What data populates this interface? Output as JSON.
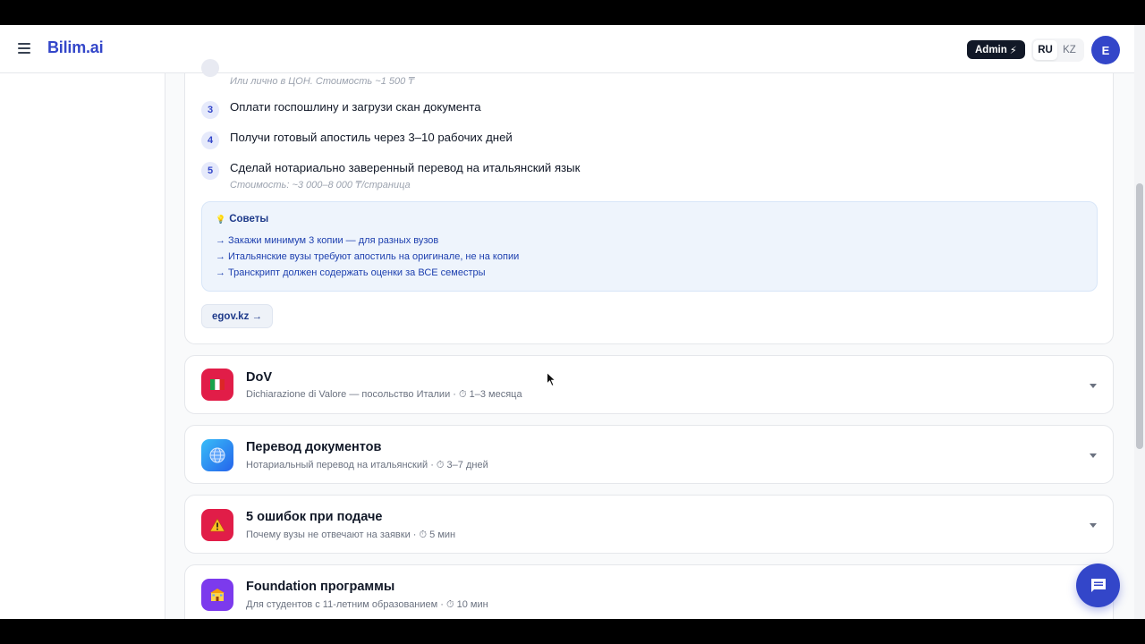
{
  "header": {
    "brand": "Bilim.ai",
    "admin_label": "Admin",
    "admin_icon": "⚡",
    "lang_options": [
      "RU",
      "KZ"
    ],
    "lang_active": "RU",
    "avatar_letter": "E"
  },
  "apostille": {
    "prev_step_note": "Или лично в ЦОН. Стоимость ~1 500 ₸",
    "steps": [
      {
        "num": "3",
        "title": "Оплати госпошлину и загрузи скан документа",
        "sub": ""
      },
      {
        "num": "4",
        "title": "Получи готовый апостиль через 3–10 рабочих дней",
        "sub": ""
      },
      {
        "num": "5",
        "title": "Сделай нотариально заверенный перевод на итальянский язык",
        "sub": "Стоимость: ~3 000–8 000 ₸/страница"
      }
    ],
    "tips_icon": "💡",
    "tips_title": "Советы",
    "tips": [
      "→ Закажи минимум 3 копии — для разных вузов",
      "→ Итальянские вузы требуют апостиль на оригинале, не на копии",
      "→ Транскрипт должен содержать оценки за ВСЕ семестры"
    ],
    "link_label": "egov.kz →"
  },
  "accordion": [
    {
      "icon": "🇮🇹",
      "icon_bg": "#e11d48",
      "title": "DoV",
      "meta": "Dichiarazione di Valore — посольство Италии · ⏱ 1–3 месяца"
    },
    {
      "icon": "🌐",
      "icon_bg": "#2563eb",
      "title": "Перевод документов",
      "meta": "Нотариальный перевод на итальянский · ⏱ 3–7 дней"
    },
    {
      "icon": "⚠",
      "icon_bg": "#e11d48",
      "title": "5 ошибок при подаче",
      "meta": "Почему вузы не отвечают на заявки · ⏱ 5 мин"
    },
    {
      "icon": "🏫",
      "icon_bg": "#7c3aed",
      "title": "Foundation программы",
      "meta": "Для студентов с 11-летним образованием · ⏱ 10 мин"
    }
  ],
  "colors": {
    "brand": "#3346c9",
    "tips_bg": "#eef4fc"
  }
}
